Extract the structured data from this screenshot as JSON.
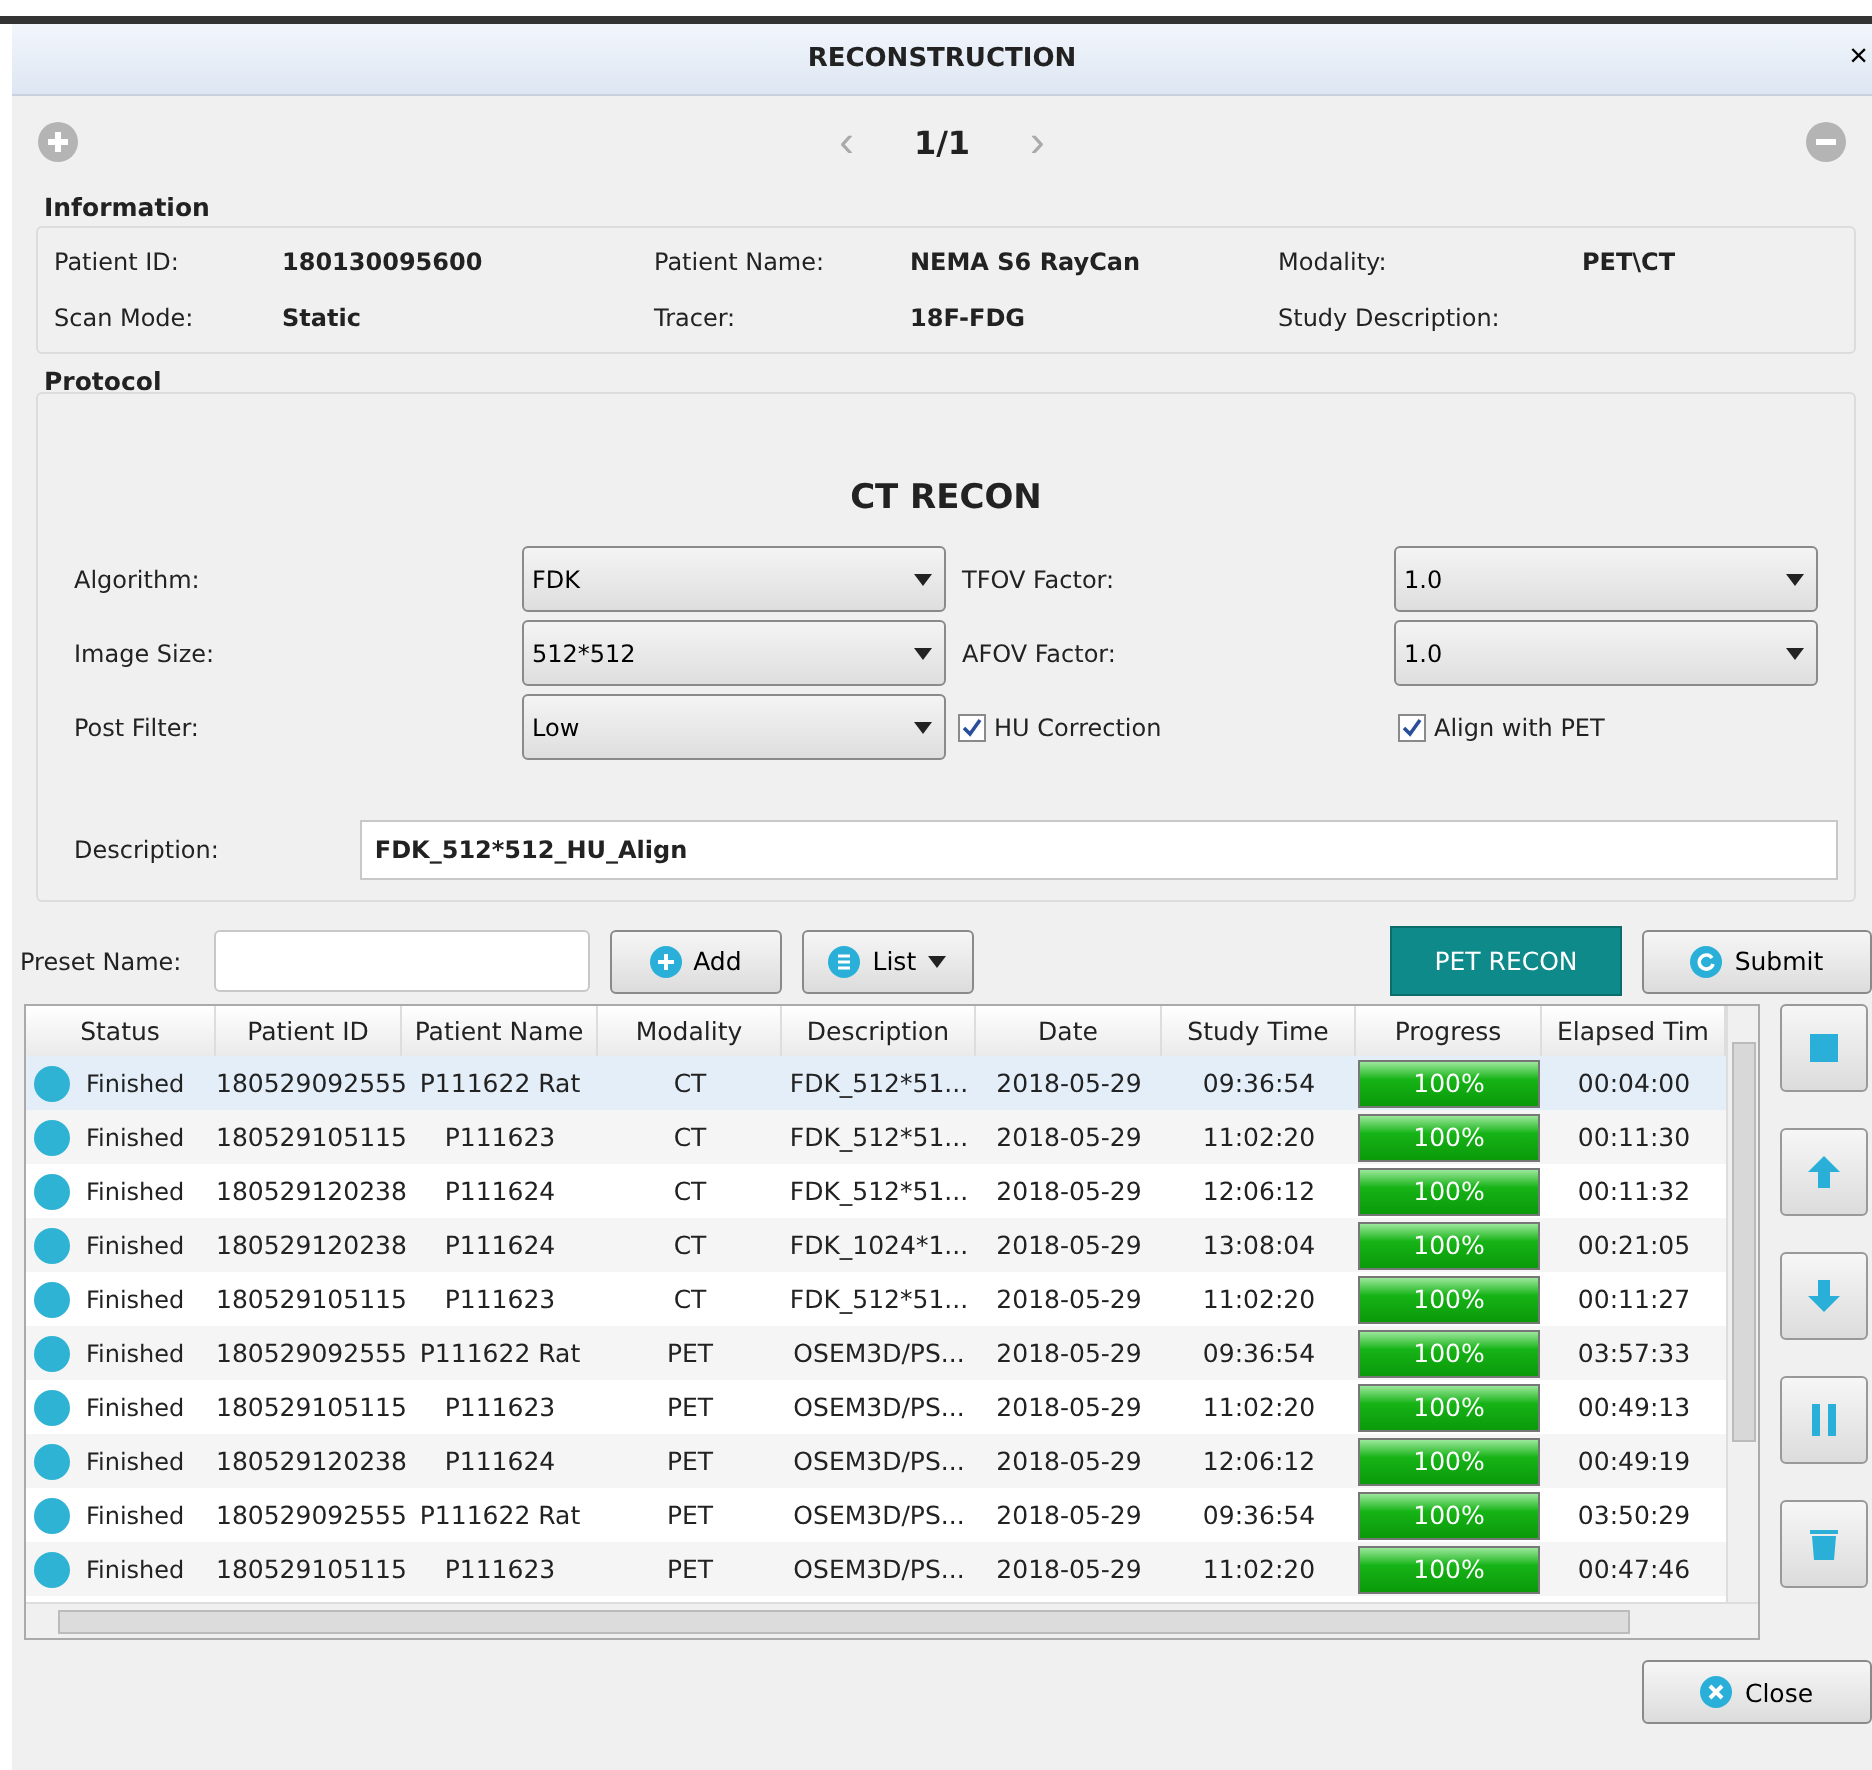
{
  "window": {
    "title": "RECONSTRUCTION",
    "close": "×"
  },
  "pager": {
    "prev": "‹",
    "page": "1/1",
    "next": "›"
  },
  "information": {
    "title": "Information",
    "fields": [
      {
        "label": "Patient ID:",
        "value": "180130095600"
      },
      {
        "label": "Patient Name:",
        "value": "NEMA S6 RayCan"
      },
      {
        "label": "Modality:",
        "value": "PET\\CT"
      },
      {
        "label": "Scan Mode:",
        "value": "Static"
      },
      {
        "label": "Tracer:",
        "value": "18F-FDG"
      },
      {
        "label": "Study Description:"
      }
    ]
  },
  "protocol": {
    "title": "Protocol",
    "heading": "CT RECON",
    "rows": [
      {
        "label": "Algorithm:",
        "value": "FDK",
        "right": {
          "kind": "select",
          "label": "TFOV Factor:",
          "value": "1.0"
        }
      },
      {
        "label": "Image Size:",
        "value": "512*512",
        "right": {
          "kind": "select",
          "label": "AFOV Factor:",
          "value": "1.0"
        }
      },
      {
        "label": "Post Filter:",
        "value": "Low",
        "right": {
          "kind": "checks",
          "items": [
            {
              "label": "HU Correction",
              "checked": true
            },
            {
              "label": "Align with PET",
              "checked": true
            }
          ]
        }
      }
    ],
    "description": {
      "label": "Description:",
      "value": "FDK_512*512_HU_Align"
    }
  },
  "preset": {
    "label": "Preset Name:",
    "add": "Add",
    "list": "List",
    "pet_recon": "PET RECON",
    "submit": "Submit"
  },
  "table": {
    "columns": [
      "Status",
      "Patient ID",
      "Patient Name",
      "Modality",
      "Description",
      "Date",
      "Study Time",
      "Progress",
      "Elapsed Tim"
    ],
    "rows": [
      {
        "color": "#2fb3d4",
        "status": "Finished",
        "id": "180529092555",
        "name": "P111622 Rat",
        "modality": "CT",
        "description": "FDK_512*51...",
        "date": "2018-05-29",
        "time": "09:36:54",
        "level": 1,
        "progress": "100%",
        "elapsed": "00:04:00",
        "selected": true
      },
      {
        "color": "#2fb3d4",
        "status": "Finished",
        "id": "180529105115",
        "name": "P111623",
        "modality": "CT",
        "description": "FDK_512*51...",
        "date": "2018-05-29",
        "time": "11:02:20",
        "level": 1,
        "progress": "100%",
        "elapsed": "00:11:30",
        "selected": false
      },
      {
        "color": "#2fb3d4",
        "status": "Finished",
        "id": "180529120238",
        "name": "P111624",
        "modality": "CT",
        "description": "FDK_512*51...",
        "date": "2018-05-29",
        "time": "12:06:12",
        "level": 1,
        "progress": "100%",
        "elapsed": "00:11:32",
        "selected": false
      },
      {
        "color": "#2fb3d4",
        "status": "Finished",
        "id": "180529120238",
        "name": "P111624",
        "modality": "CT",
        "description": "FDK_1024*1...",
        "date": "2018-05-29",
        "time": "13:08:04",
        "level": 1,
        "progress": "100%",
        "elapsed": "00:21:05",
        "selected": false
      },
      {
        "color": "#2fb3d4",
        "status": "Finished",
        "id": "180529105115",
        "name": "P111623",
        "modality": "CT",
        "description": "FDK_512*51...",
        "date": "2018-05-29",
        "time": "11:02:20",
        "level": 1,
        "progress": "100%",
        "elapsed": "00:11:27",
        "selected": false
      },
      {
        "color": "#2fb3d4",
        "status": "Finished",
        "id": "180529092555",
        "name": "P111622 Rat",
        "modality": "PET",
        "description": "OSEM3D/PS...",
        "date": "2018-05-29",
        "time": "09:36:54",
        "level": 1,
        "progress": "100%",
        "elapsed": "03:57:33",
        "selected": false
      },
      {
        "color": "#2fb3d4",
        "status": "Finished",
        "id": "180529105115",
        "name": "P111623",
        "modality": "PET",
        "description": "OSEM3D/PS...",
        "date": "2018-05-29",
        "time": "11:02:20",
        "level": 1,
        "progress": "100%",
        "elapsed": "00:49:13",
        "selected": false
      },
      {
        "color": "#2fb3d4",
        "status": "Finished",
        "id": "180529120238",
        "name": "P111624",
        "modality": "PET",
        "description": "OSEM3D/PS...",
        "date": "2018-05-29",
        "time": "12:06:12",
        "level": 1,
        "progress": "100%",
        "elapsed": "00:49:19",
        "selected": false
      },
      {
        "color": "#2fb3d4",
        "status": "Finished",
        "id": "180529092555",
        "name": "P111622 Rat",
        "modality": "PET",
        "description": "OSEM3D/PS...",
        "date": "2018-05-29",
        "time": "09:36:54",
        "level": 1,
        "progress": "100%",
        "elapsed": "03:50:29",
        "selected": false
      },
      {
        "color": "#2fb3d4",
        "status": "Finished",
        "id": "180529105115",
        "name": "P111623",
        "modality": "PET",
        "description": "OSEM3D/PS...",
        "date": "2018-05-29",
        "time": "11:02:20",
        "level": 1,
        "progress": "100%",
        "elapsed": "00:47:46",
        "selected": false
      }
    ]
  },
  "close_button": "Close"
}
